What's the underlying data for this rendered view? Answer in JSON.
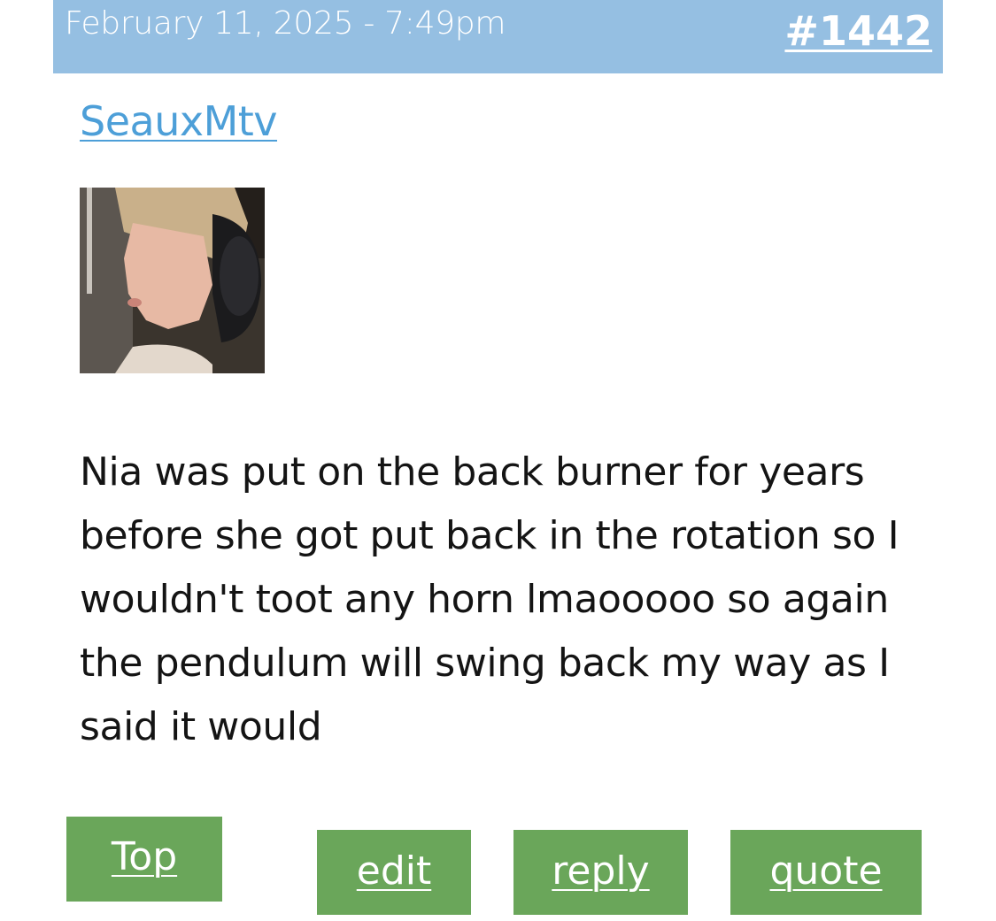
{
  "post": {
    "date": "February 11, 2025 - 7:49pm",
    "number": "#1442",
    "username": "SeauxMtv",
    "avatar_alt": "avatar-photo",
    "body": "Nia was put on the back burner for years before she got put back in the rotation so I wouldn't toot any horn lmaooooo so again the pendulum will swing back my way as I said it would"
  },
  "actions": {
    "top_label": "Top",
    "edit_label": "edit",
    "reply_label": "reply",
    "quote_label": "quote"
  },
  "colors": {
    "header_bg": "#95bfe2",
    "username_link": "#4d9fd8",
    "button_bg": "#6aa65a",
    "text": "#141414"
  }
}
